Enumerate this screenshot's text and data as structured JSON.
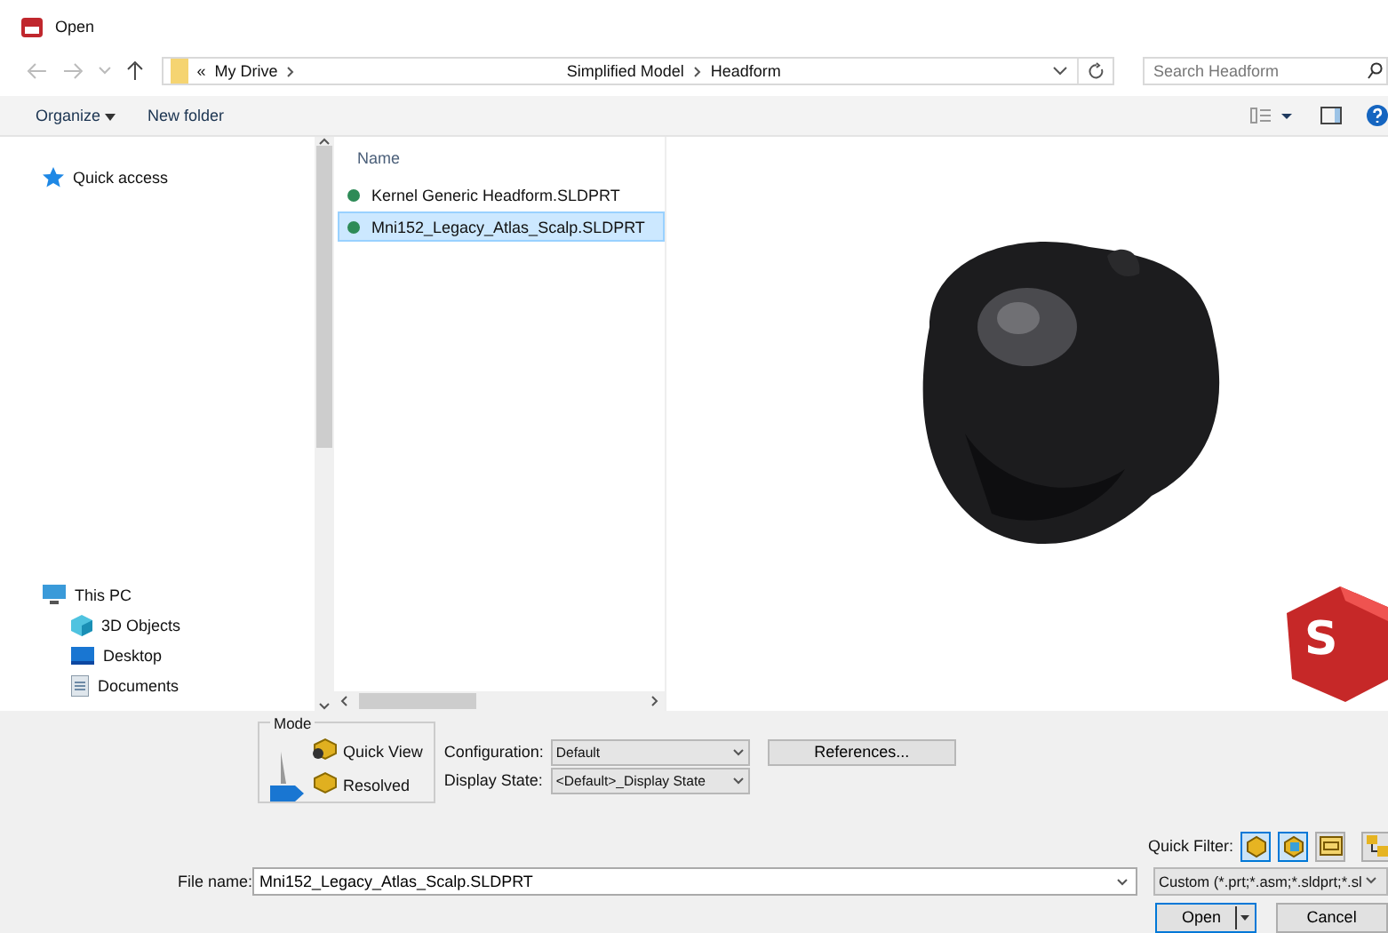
{
  "window": {
    "title": "Open"
  },
  "address": {
    "crumbs": [
      "«",
      "My Drive",
      "Simplified Model",
      "Headform"
    ],
    "search_placeholder": "Search Headform"
  },
  "toolbar": {
    "organize": "Organize",
    "new_folder": "New folder"
  },
  "sidebar": {
    "items": [
      {
        "label": "Quick access",
        "kind": "star"
      },
      {
        "label": "This PC",
        "kind": "pc",
        "children": [
          {
            "label": "3D Objects",
            "kind": "cube"
          },
          {
            "label": "Desktop",
            "kind": "desktop"
          },
          {
            "label": "Documents",
            "kind": "doc"
          }
        ]
      }
    ]
  },
  "files": {
    "column": "Name",
    "rows": [
      {
        "name": "Kernel Generic Headform.SLDPRT",
        "selected": false
      },
      {
        "name": "Mni152_Legacy_Atlas_Scalp.SLDPRT",
        "selected": true
      }
    ]
  },
  "preview": {
    "kind": "picture",
    "logo_text": "S"
  },
  "mode": {
    "label": "Mode",
    "options": [
      {
        "label": "Quick View",
        "selected": false
      },
      {
        "label": "Resolved",
        "selected": true
      }
    ]
  },
  "configuration": {
    "label": "Configuration:",
    "value": "Default"
  },
  "display_state": {
    "label": "Display State:",
    "value": "<Default>_Display State"
  },
  "references": "References...",
  "quick_filter": {
    "label": "Quick Filter:",
    "filters": [
      {
        "kind": "part",
        "selected": true
      },
      {
        "kind": "assembly",
        "selected": true
      },
      {
        "kind": "drawing",
        "selected": false
      },
      {
        "kind": "top",
        "selected": false
      }
    ]
  },
  "file_name": {
    "label": "File name:",
    "value": "Mni152_Legacy_Atlas_Scalp.SLDPRT"
  },
  "file_type": "Custom (*.prt;*.asm;*.sldprt;*.sl",
  "buttons": {
    "open": "Open",
    "cancel": "Cancel"
  }
}
